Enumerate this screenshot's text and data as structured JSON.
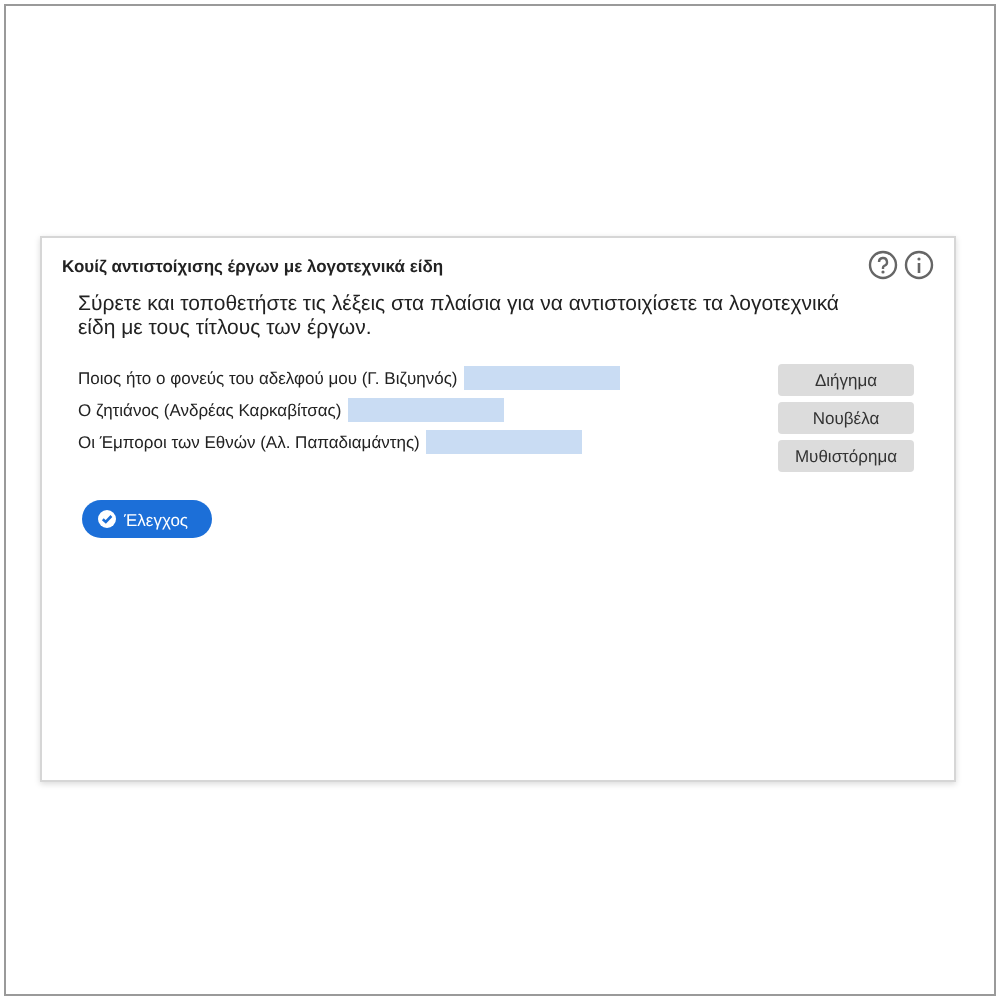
{
  "quiz": {
    "title": "Κουίζ αντιστοίχισης έργων με λογοτεχνικά είδη",
    "instructions": "Σύρετε και τοποθετήστε τις λέξεις στα πλαίσια για να αντιστοιχίσετε τα λογοτεχνικά είδη με τους τίτλους των έργων.",
    "items": [
      {
        "label": "Ποιος ήτο ο φονεύς του αδελφού μου (Γ. Βιζυηνός)"
      },
      {
        "label": "Ο ζητιάνος (Ανδρέας Καρκαβίτσας)"
      },
      {
        "label": "Οι Έμποροι των Εθνών (Αλ. Παπαδιαμάντης)"
      }
    ],
    "choices": [
      "Διήγημα",
      "Νουβέλα",
      "Μυθιστόρημα"
    ],
    "check_button": "Έλεγχος"
  }
}
